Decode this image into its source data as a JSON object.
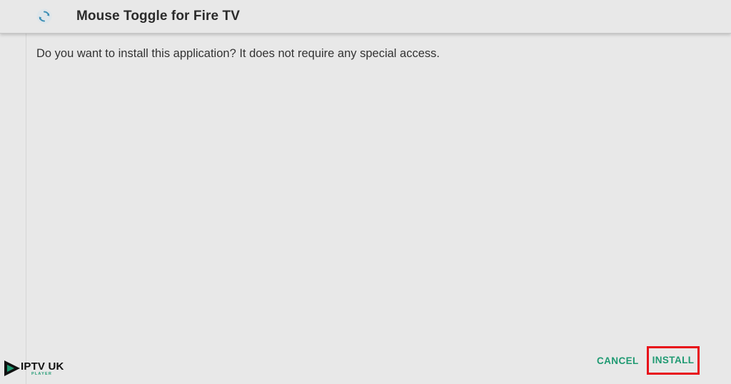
{
  "window": {
    "app_title": "Mouse Toggle for Fire TV",
    "app_icon": "refresh-icon"
  },
  "dialog": {
    "prompt": "Do you want to install this application? It does not require any special access.",
    "cancel_label": "CANCEL",
    "install_label": "INSTALL"
  },
  "watermark": {
    "logo_icon": "play-icon",
    "text": "IPTV UK",
    "subtext": "PLAYER"
  },
  "colors": {
    "background": "#e8e8e8",
    "button_text": "#1f9a72",
    "highlight_border": "#e8101a",
    "title_text": "#2b2b2b"
  }
}
